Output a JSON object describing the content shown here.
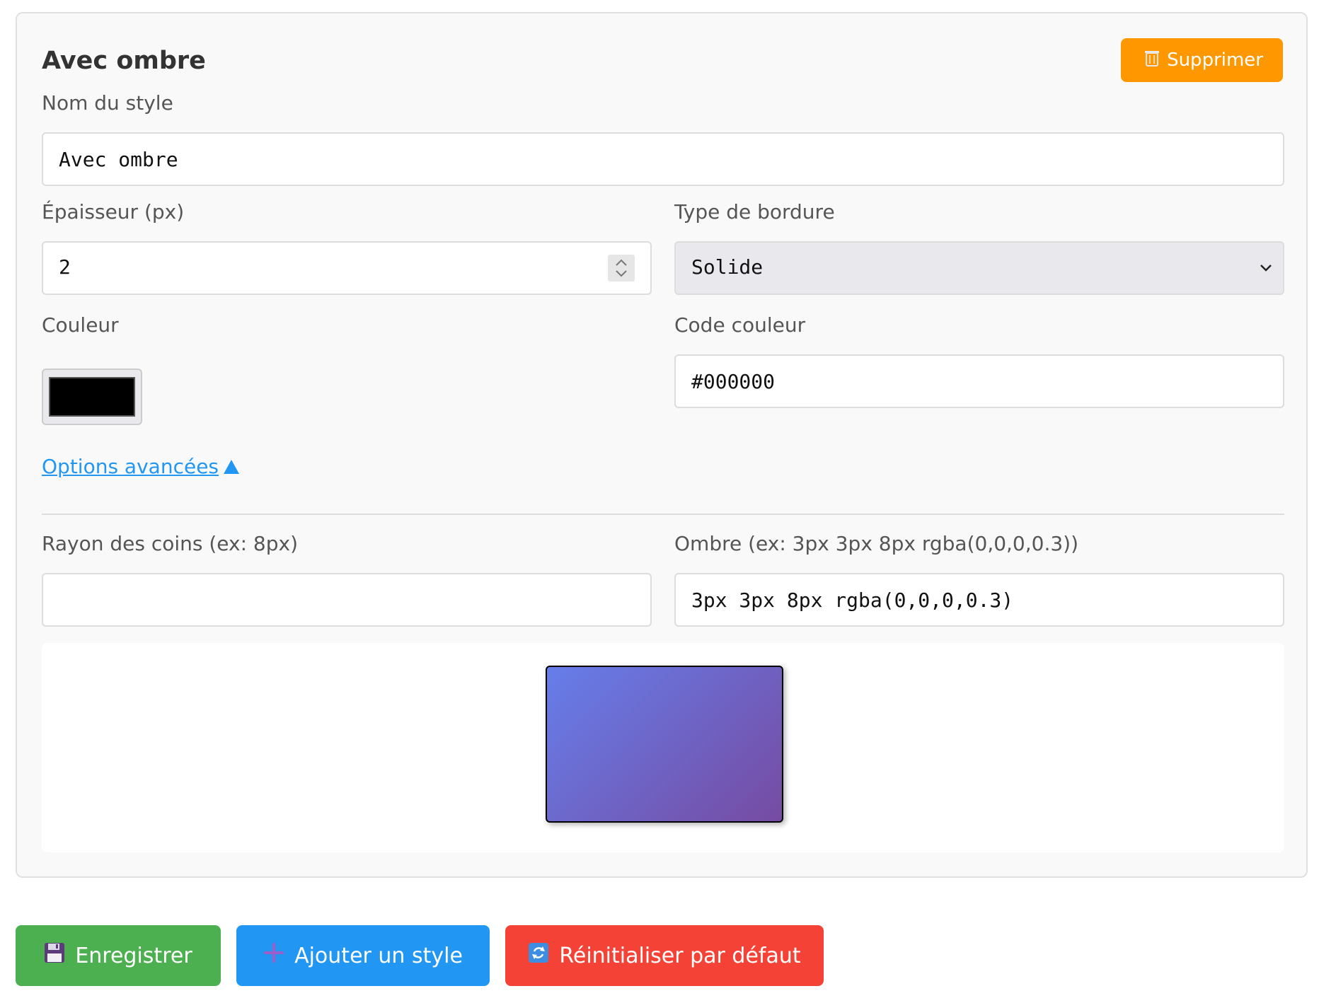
{
  "style_card": {
    "title": "Avec ombre",
    "delete_button": {
      "label": "Supprimer",
      "icon": "trash-icon",
      "color": "#ff9800"
    },
    "name_field": {
      "label": "Nom du style",
      "value": "Avec ombre"
    },
    "thickness_field": {
      "label": "Épaisseur (px)",
      "value": "2"
    },
    "border_type_field": {
      "label": "Type de bordure",
      "selected": "Solide"
    },
    "color_field": {
      "label": "Couleur",
      "value": "#000000"
    },
    "color_code_field": {
      "label": "Code couleur",
      "value": "#000000"
    },
    "advanced_toggle": {
      "label": "Options avancées",
      "expanded": true,
      "icon": "triangle-up-icon"
    },
    "radius_field": {
      "label": "Rayon des coins (ex: 8px)",
      "value": ""
    },
    "shadow_field": {
      "label": "Ombre (ex: 3px 3px 8px rgba(0,0,0,0.3))",
      "value": "3px 3px 8px rgba(0,0,0,0.3)"
    },
    "preview": {
      "border_width": "2px",
      "border_style": "solid",
      "border_color": "#000000",
      "shadow": "3px 3px 8px rgba(0,0,0,0.3)",
      "fill_gradient": [
        "#667eea",
        "#764ba2"
      ]
    }
  },
  "actions": {
    "save": {
      "label": "Enregistrer",
      "icon": "floppy-disk-icon",
      "color": "#4caf50"
    },
    "add": {
      "label": "Ajouter un style",
      "icon": "plus-icon",
      "color": "#2196f3"
    },
    "reset": {
      "label": "Réinitialiser par défaut",
      "icon": "refresh-icon",
      "color": "#f44336"
    }
  }
}
